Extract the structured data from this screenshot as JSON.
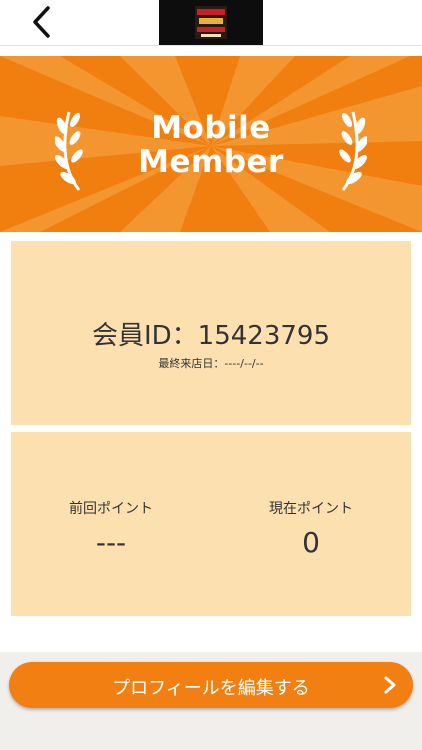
{
  "header": {
    "back_icon": "chevron-left-icon",
    "logo_icon": "restaurant-logo-icon"
  },
  "banner": {
    "line1": "Mobile",
    "line2": "Member",
    "color": "#f07f10",
    "left_icon": "laurel-branch-icon",
    "right_icon": "laurel-branch-icon"
  },
  "member": {
    "id_text": "会員ID：15423795",
    "last_visit": "最終来店日：----/--/--"
  },
  "points": {
    "previous_label": "前回ポイント",
    "previous_value": "---",
    "current_label": "現在ポイント",
    "current_value": "0"
  },
  "footer": {
    "edit_button": "プロフィールを編集する",
    "edit_icon": "chevron-right-icon",
    "accent": "#f17f12"
  }
}
